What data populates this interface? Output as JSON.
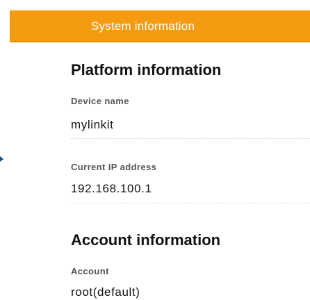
{
  "header": {
    "title": "System information"
  },
  "platform": {
    "title": "Platform information",
    "device_name_label": "Device name",
    "device_name_value": "mylinkit",
    "ip_label": "Current IP address",
    "ip_value": "192.168.100.1"
  },
  "account": {
    "title": "Account information",
    "account_label": "Account",
    "account_value": "root(default)"
  },
  "colors": {
    "header_bg": "#f59b12",
    "header_text": "#ffffff"
  }
}
